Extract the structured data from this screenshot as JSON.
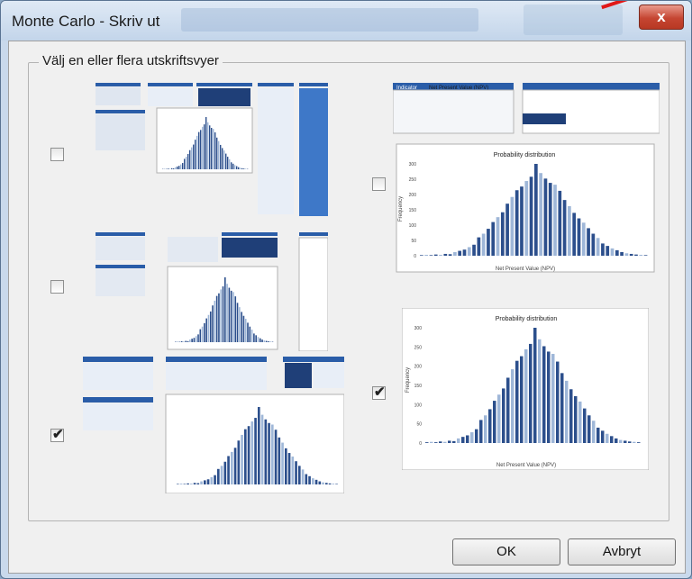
{
  "window": {
    "title": "Monte Carlo - Skriv ut",
    "close_glyph": "x"
  },
  "group": {
    "label": "Välj en eller flera utskriftsvyer"
  },
  "options": [
    {
      "checked": false,
      "check_glyph": ""
    },
    {
      "checked": false,
      "check_glyph": ""
    },
    {
      "checked": true,
      "check_glyph": "✔"
    },
    {
      "checked": false,
      "check_glyph": ""
    },
    {
      "checked": true,
      "check_glyph": "✔"
    }
  ],
  "preview_large_1": {
    "header_left": "Indicator",
    "header_mid": "Net Present Value (NPV)",
    "chart_title": "Probability distribution",
    "xlabel": "Net Present Value (NPV)",
    "ylabel": "Frequency",
    "yticks": [
      "300",
      "250",
      "200",
      "150",
      "100",
      "50",
      "0"
    ]
  },
  "preview_large_2": {
    "chart_title": "Probability distribution",
    "xlabel": "Net Present Value (NPV)",
    "ylabel": "Frequency",
    "yticks": [
      "300",
      "250",
      "200",
      "150",
      "100",
      "50",
      "0"
    ]
  },
  "histogram": [
    2,
    3,
    2,
    4,
    3,
    6,
    5,
    12,
    16,
    20,
    28,
    36,
    60,
    72,
    88,
    110,
    126,
    142,
    170,
    192,
    214,
    226,
    244,
    258,
    300,
    270,
    252,
    238,
    232,
    212,
    182,
    162,
    140,
    122,
    108,
    90,
    72,
    58,
    40,
    32,
    24,
    18,
    12,
    8,
    6,
    4,
    3,
    2
  ],
  "buttons": {
    "ok_label": "OK",
    "cancel_label": "Avbryt"
  }
}
